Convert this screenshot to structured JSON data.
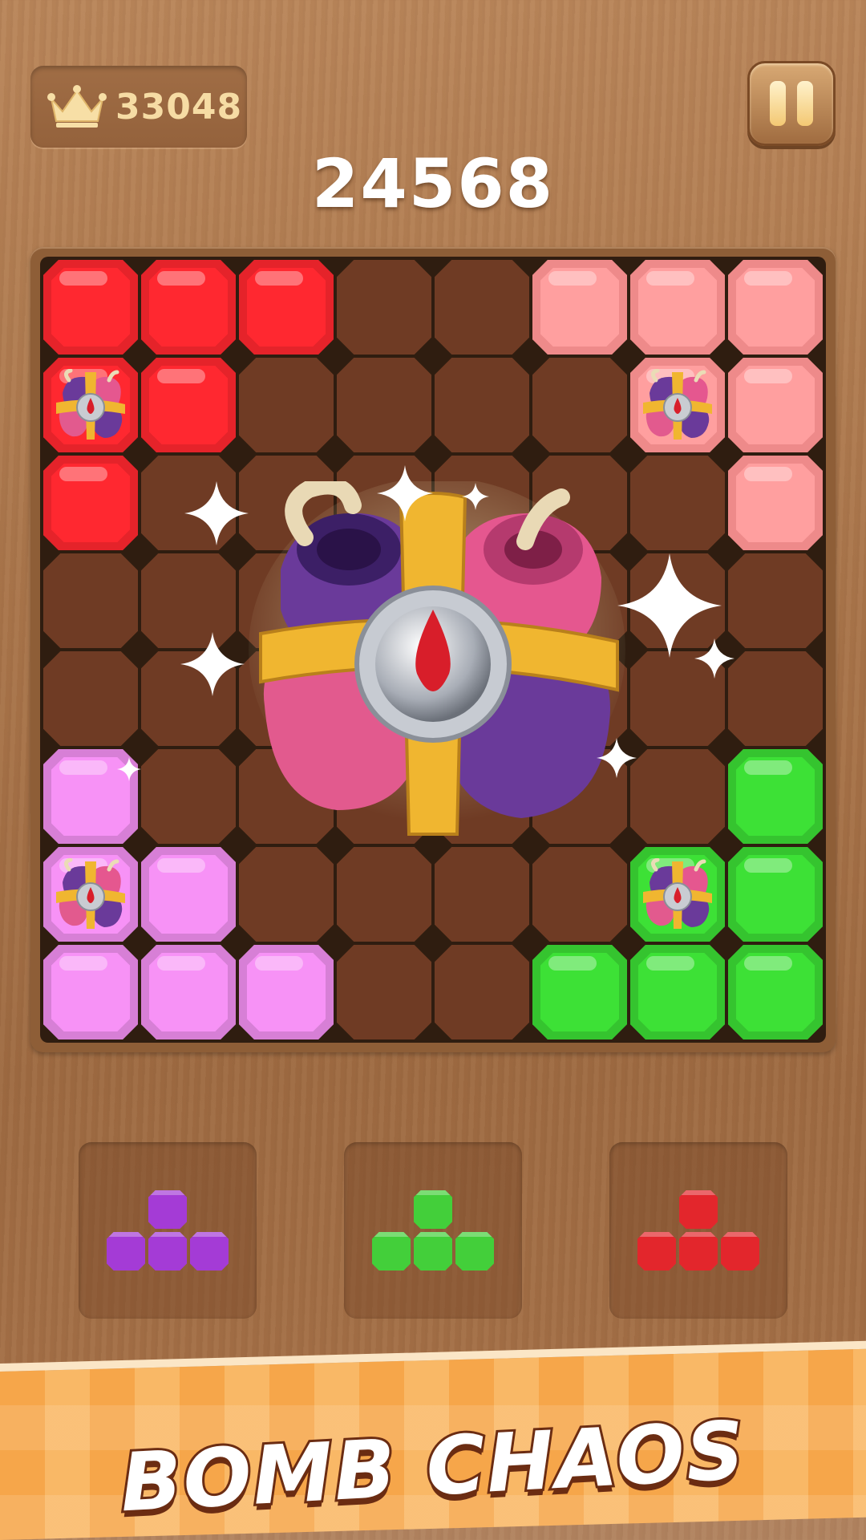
{
  "hud": {
    "best_score": "33048",
    "current_score": "24568",
    "best_icon": "crown-icon",
    "pause_icon": "pause-icon"
  },
  "board": {
    "size": 8,
    "colors": {
      "R": "#e5232a",
      "P": "#ee8a8a",
      "V": "#d77fd6",
      "G": "#35c42f"
    },
    "rows": [
      [
        "R",
        "R",
        "R",
        "",
        "",
        "P",
        "P",
        "P"
      ],
      [
        "R*",
        "R",
        "",
        "",
        "",
        "",
        "P*",
        "P"
      ],
      [
        "R",
        "",
        "",
        "",
        "",
        "",
        "",
        "P"
      ],
      [
        "",
        "",
        "",
        "",
        "",
        "",
        "",
        ""
      ],
      [
        "",
        "",
        "",
        "",
        "",
        "",
        "",
        ""
      ],
      [
        "V",
        "",
        "",
        "",
        "",
        "",
        "",
        "G"
      ],
      [
        "V*",
        "V",
        "",
        "",
        "",
        "",
        "G*",
        "G"
      ],
      [
        "V",
        "V",
        "V",
        "",
        "",
        "G",
        "G",
        "G"
      ]
    ],
    "center_item": "bomb-icon"
  },
  "tray": [
    {
      "color": "#a43bd6"
    },
    {
      "color": "#43cf3a"
    },
    {
      "color": "#e3262c"
    }
  ],
  "banner": {
    "text": "BOMB CHAOS"
  }
}
